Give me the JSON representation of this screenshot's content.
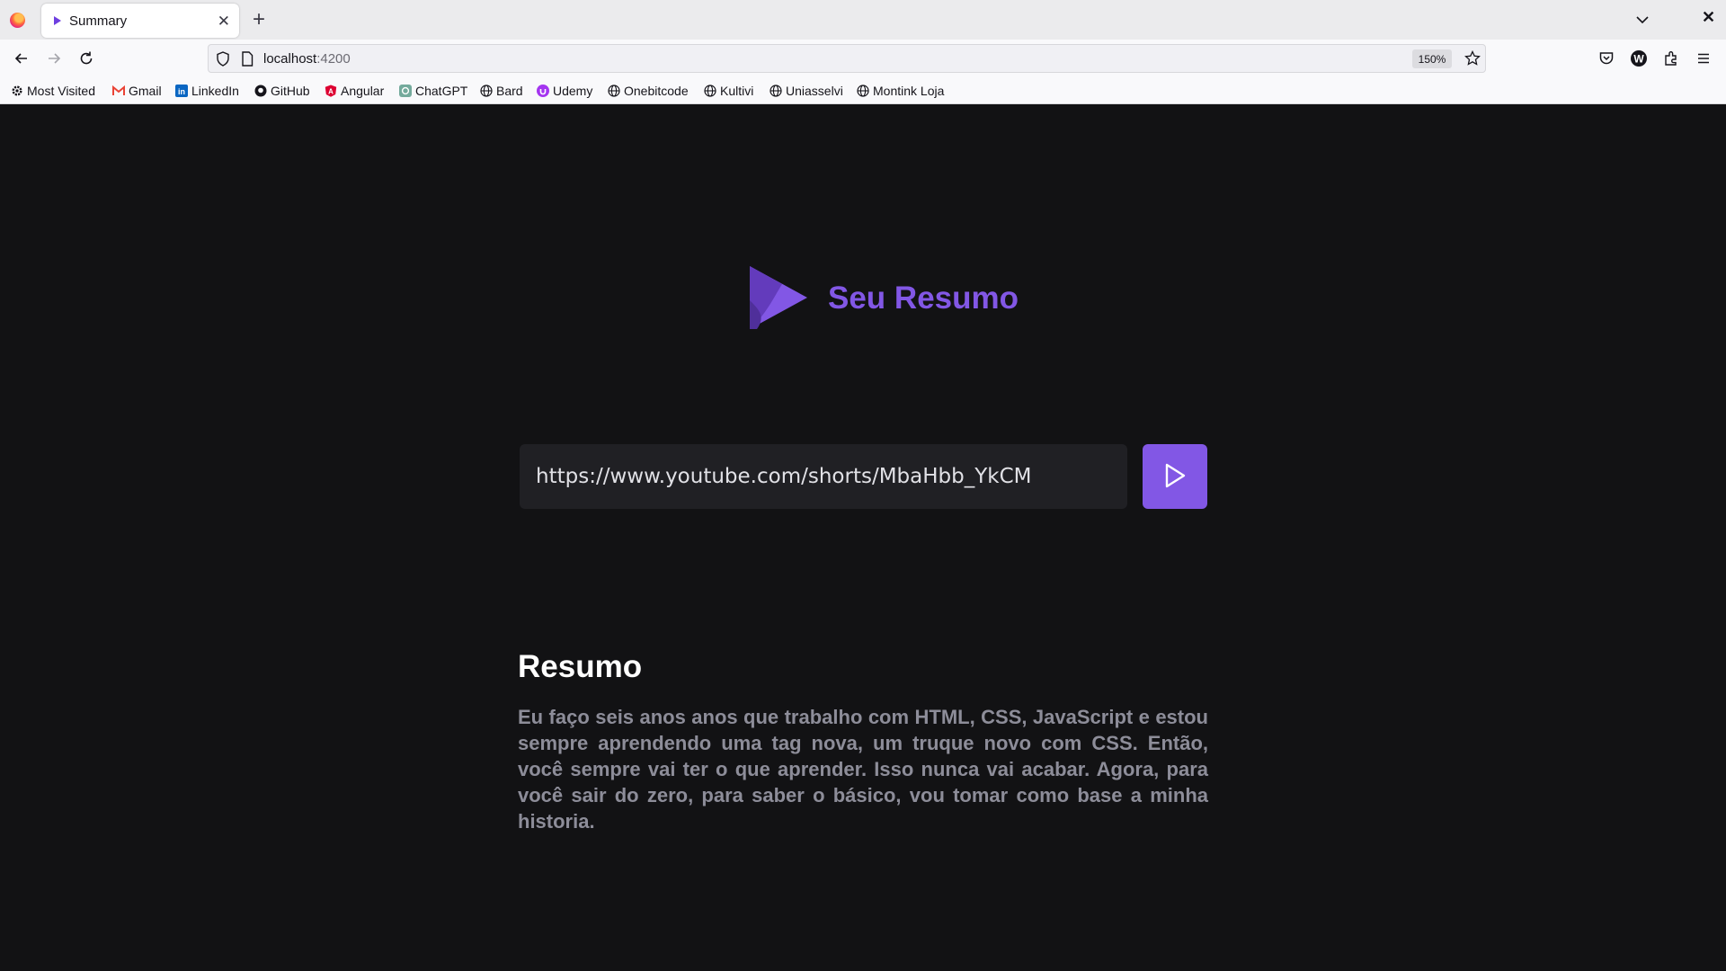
{
  "browser": {
    "tab_title": "Summary",
    "url_host": "localhost",
    "url_port": ":4200",
    "zoom": "150%",
    "bookmarks": [
      {
        "label": "Most Visited",
        "icon": "gear-icon"
      },
      {
        "label": "Gmail",
        "icon": "gmail-icon"
      },
      {
        "label": "LinkedIn",
        "icon": "linkedin-icon"
      },
      {
        "label": "GitHub",
        "icon": "github-icon"
      },
      {
        "label": "Angular",
        "icon": "angular-icon"
      },
      {
        "label": "ChatGPT",
        "icon": "chatgpt-icon"
      },
      {
        "label": "Bard",
        "icon": "globe-icon"
      },
      {
        "label": "Udemy",
        "icon": "udemy-icon"
      },
      {
        "label": "Onebitcode",
        "icon": "globe-icon"
      },
      {
        "label": "Kultivi",
        "icon": "globe-icon"
      },
      {
        "label": "Uniasselvi",
        "icon": "globe-icon"
      },
      {
        "label": "Montink Loja",
        "icon": "globe-icon"
      }
    ]
  },
  "app": {
    "brand": "Seu Resumo",
    "input_value": "https://www.youtube.com/shorts/MbaHbb_YkCM",
    "summary_title": "Resumo",
    "summary_text": "Eu faço seis anos anos que trabalho com HTML, CSS, JavaScript e estou sempre aprendendo uma tag nova, um truque novo com CSS. Então, você sempre vai ter o que aprender. Isso nunca vai acabar. Agora, para você sair do zero, para saber o básico, vou tomar como base a minha historia."
  },
  "colors": {
    "accent": "#8257e5",
    "background": "#121214",
    "input_bg": "#202024",
    "summary_text": "#8d8d99"
  }
}
